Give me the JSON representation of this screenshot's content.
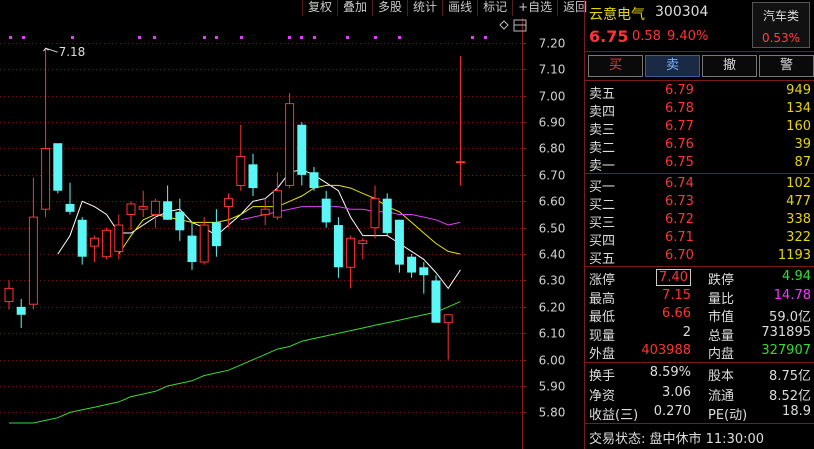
{
  "toolbar": [
    "复权",
    "叠加",
    "多股",
    "统计",
    "画线",
    "标记",
    "+自选",
    "返回"
  ],
  "chart_data": {
    "type": "candlestick",
    "y_ticks": [
      "7.20",
      "7.10",
      "7.00",
      "6.90",
      "6.80",
      "6.70",
      "6.60",
      "6.50",
      "6.40",
      "6.30",
      "6.20",
      "6.10",
      "6.00",
      "5.90",
      "5.80"
    ],
    "ylim": [
      5.76,
      7.23
    ],
    "high_annotation": "7.18",
    "candles": [
      {
        "o": 6.22,
        "h": 6.3,
        "l": 6.19,
        "c": 6.27
      },
      {
        "o": 6.2,
        "h": 6.23,
        "l": 6.12,
        "c": 6.17
      },
      {
        "o": 6.21,
        "h": 6.69,
        "l": 6.19,
        "c": 6.54
      },
      {
        "o": 6.57,
        "h": 7.18,
        "l": 6.54,
        "c": 6.8
      },
      {
        "o": 6.82,
        "h": 6.81,
        "l": 6.63,
        "c": 6.64
      },
      {
        "o": 6.59,
        "h": 6.67,
        "l": 6.55,
        "c": 6.56
      },
      {
        "o": 6.53,
        "h": 6.54,
        "l": 6.36,
        "c": 6.39
      },
      {
        "o": 6.43,
        "h": 6.47,
        "l": 6.37,
        "c": 6.46
      },
      {
        "o": 6.39,
        "h": 6.5,
        "l": 6.38,
        "c": 6.49
      },
      {
        "o": 6.41,
        "h": 6.55,
        "l": 6.38,
        "c": 6.51
      },
      {
        "o": 6.55,
        "h": 6.6,
        "l": 6.49,
        "c": 6.59
      },
      {
        "o": 6.57,
        "h": 6.64,
        "l": 6.54,
        "c": 6.58
      },
      {
        "o": 6.55,
        "h": 6.61,
        "l": 6.5,
        "c": 6.6
      },
      {
        "o": 6.6,
        "h": 6.66,
        "l": 6.53,
        "c": 6.53
      },
      {
        "o": 6.56,
        "h": 6.61,
        "l": 6.45,
        "c": 6.49
      },
      {
        "o": 6.47,
        "h": 6.52,
        "l": 6.34,
        "c": 6.37
      },
      {
        "o": 6.37,
        "h": 6.54,
        "l": 6.36,
        "c": 6.51
      },
      {
        "o": 6.52,
        "h": 6.57,
        "l": 6.39,
        "c": 6.43
      },
      {
        "o": 6.58,
        "h": 6.63,
        "l": 6.5,
        "c": 6.61
      },
      {
        "o": 6.66,
        "h": 6.89,
        "l": 6.64,
        "c": 6.77
      },
      {
        "o": 6.74,
        "h": 6.78,
        "l": 6.62,
        "c": 6.65
      },
      {
        "o": 6.55,
        "h": 6.61,
        "l": 6.51,
        "c": 6.57
      },
      {
        "o": 6.54,
        "h": 6.71,
        "l": 6.53,
        "c": 6.64
      },
      {
        "o": 6.66,
        "h": 7.01,
        "l": 6.65,
        "c": 6.97
      },
      {
        "o": 6.89,
        "h": 6.9,
        "l": 6.66,
        "c": 6.7
      },
      {
        "o": 6.71,
        "h": 6.73,
        "l": 6.64,
        "c": 6.65
      },
      {
        "o": 6.61,
        "h": 6.64,
        "l": 6.5,
        "c": 6.52
      },
      {
        "o": 6.51,
        "h": 6.54,
        "l": 6.31,
        "c": 6.35
      },
      {
        "o": 6.35,
        "h": 6.47,
        "l": 6.27,
        "c": 6.46
      },
      {
        "o": 6.44,
        "h": 6.46,
        "l": 6.38,
        "c": 6.45
      },
      {
        "o": 6.5,
        "h": 6.66,
        "l": 6.46,
        "c": 6.61
      },
      {
        "o": 6.61,
        "h": 6.63,
        "l": 6.47,
        "c": 6.48
      },
      {
        "o": 6.53,
        "h": 6.53,
        "l": 6.33,
        "c": 6.36
      },
      {
        "o": 6.39,
        "h": 6.4,
        "l": 6.31,
        "c": 6.33
      },
      {
        "o": 6.35,
        "h": 6.37,
        "l": 6.25,
        "c": 6.32
      },
      {
        "o": 6.3,
        "h": 6.32,
        "l": 6.15,
        "c": 6.14
      },
      {
        "o": 6.14,
        "h": 6.16,
        "l": 6.0,
        "c": 6.17
      },
      {
        "o": 6.75,
        "h": 7.15,
        "l": 6.66,
        "c": 6.75
      }
    ],
    "ma_colors": [
      "#ffffff",
      "#e6e600",
      "#e040fb",
      "#33dd33"
    ],
    "ma": [
      [
        null,
        null,
        null,
        null,
        6.4,
        6.47,
        6.6,
        6.58,
        6.55,
        6.48,
        6.48,
        6.51,
        6.54,
        6.56,
        6.57,
        6.52,
        6.5,
        6.47,
        6.51,
        6.55,
        6.6,
        6.61,
        6.65,
        6.71,
        6.72,
        6.7,
        6.67,
        6.64,
        6.54,
        6.47,
        6.47,
        6.47,
        6.44,
        6.41,
        6.38,
        6.33,
        6.27,
        6.34
      ],
      [
        null,
        null,
        null,
        null,
        null,
        null,
        null,
        null,
        null,
        6.4,
        6.47,
        6.53,
        6.55,
        6.54,
        6.53,
        6.52,
        6.52,
        6.52,
        6.53,
        6.55,
        6.58,
        6.58,
        6.58,
        6.6,
        6.62,
        6.65,
        6.66,
        6.66,
        6.65,
        6.63,
        6.61,
        6.58,
        6.56,
        6.52,
        6.48,
        6.44,
        6.41,
        6.4
      ],
      [
        null,
        null,
        null,
        null,
        null,
        null,
        null,
        null,
        null,
        null,
        null,
        null,
        null,
        null,
        null,
        null,
        null,
        null,
        null,
        6.53,
        6.54,
        6.55,
        6.56,
        6.57,
        6.58,
        6.58,
        6.58,
        6.58,
        6.57,
        6.57,
        6.56,
        6.56,
        6.55,
        6.55,
        6.54,
        6.53,
        6.51,
        6.52
      ],
      [
        5.76,
        5.76,
        5.76,
        5.77,
        5.78,
        5.8,
        5.81,
        5.82,
        5.83,
        5.84,
        5.86,
        5.87,
        5.88,
        5.9,
        5.91,
        5.92,
        5.94,
        5.95,
        5.96,
        5.98,
        6.0,
        6.02,
        6.04,
        6.05,
        6.07,
        6.08,
        6.09,
        6.1,
        6.11,
        6.12,
        6.13,
        6.14,
        6.15,
        6.16,
        6.17,
        6.18,
        6.2,
        6.22
      ]
    ],
    "colors": {
      "up": "#ff3333",
      "down": "#5bf7f7",
      "grid": "#6b1414",
      "axis_text": "#d0d0d0"
    }
  },
  "panel": {
    "name": "云意电气",
    "code": "300304",
    "sector": "汽车类",
    "sector_pct": "0.53%",
    "price": "6.75",
    "change": "0.58",
    "change_pct": "9.40%",
    "buttons": [
      "买",
      "卖",
      "撤",
      "警"
    ],
    "asks": [
      {
        "label": "卖五",
        "price": "6.79",
        "vol": "949"
      },
      {
        "label": "卖四",
        "price": "6.78",
        "vol": "134"
      },
      {
        "label": "卖三",
        "price": "6.77",
        "vol": "160"
      },
      {
        "label": "卖二",
        "price": "6.76",
        "vol": "39"
      },
      {
        "label": "卖一",
        "price": "6.75",
        "vol": "87"
      }
    ],
    "bids": [
      {
        "label": "买一",
        "price": "6.74",
        "vol": "102"
      },
      {
        "label": "买二",
        "price": "6.73",
        "vol": "477"
      },
      {
        "label": "买三",
        "price": "6.72",
        "vol": "338"
      },
      {
        "label": "买四",
        "price": "6.71",
        "vol": "322"
      },
      {
        "label": "买五",
        "price": "6.70",
        "vol": "1193"
      }
    ],
    "stats1": [
      {
        "l1": "涨停",
        "v1": "7.40",
        "l2": "跌停",
        "v2": "4.94"
      },
      {
        "l1": "最高",
        "v1": "7.15",
        "l2": "量比",
        "v2": "14.78"
      },
      {
        "l1": "最低",
        "v1": "6.66",
        "l2": "市值",
        "v2": "59.0亿"
      },
      {
        "l1": "现量",
        "v1": "2",
        "l2": "总量",
        "v2": "731895"
      },
      {
        "l1": "外盘",
        "v1": "403988",
        "l2": "内盘",
        "v2": "327907"
      }
    ],
    "stats2": [
      {
        "l1": "换手",
        "v1": "8.59%",
        "l2": "股本",
        "v2": "8.75亿"
      },
      {
        "l1": "净资",
        "v1": "3.06",
        "l2": "流通",
        "v2": "8.52亿"
      },
      {
        "l1": "收益(㆔)",
        "v1": "0.270",
        "l2": "PE(动)",
        "v2": "18.9"
      }
    ],
    "status": "交易状态: 盘中休市 11:30:00"
  }
}
